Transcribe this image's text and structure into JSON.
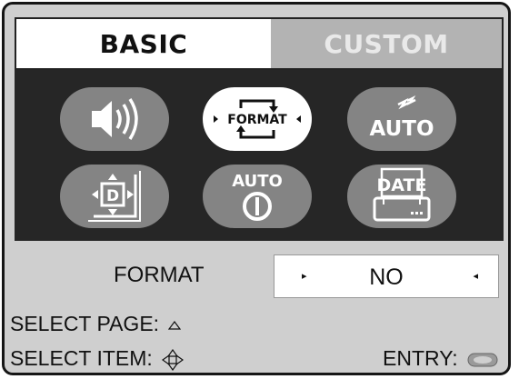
{
  "tabs": {
    "basic": "BASIC",
    "custom": "CUSTOM",
    "active": "BASIC"
  },
  "icons": [
    {
      "name": "volume-icon"
    },
    {
      "name": "format-icon",
      "label": "FORMAT",
      "selected": true
    },
    {
      "name": "auto-sleep-icon",
      "label": "AUTO"
    },
    {
      "name": "display-position-icon",
      "label": "D"
    },
    {
      "name": "auto-power-off-icon",
      "label": "AUTO"
    },
    {
      "name": "date-icon",
      "label": "DATE"
    }
  ],
  "format_setting": {
    "label": "FORMAT",
    "value": "NO"
  },
  "help": {
    "select_page": "SELECT PAGE:",
    "select_item": "SELECT ITEM:",
    "entry": "ENTRY:"
  },
  "colors": {
    "panel": "#262626",
    "pill": "#848484",
    "pill_selected": "#ffffff",
    "background": "#cfcfcf"
  }
}
